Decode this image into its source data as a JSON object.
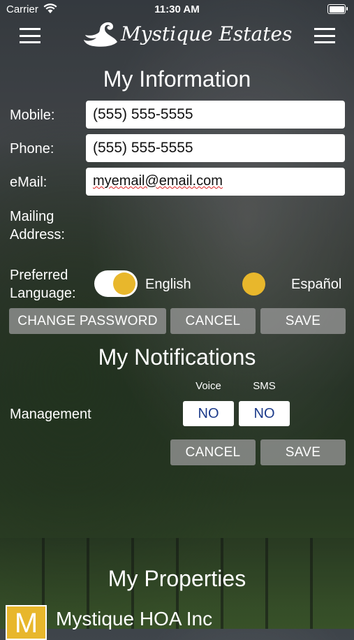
{
  "status_bar": {
    "carrier": "Carrier",
    "time": "11:30 AM"
  },
  "header": {
    "brand": "Mystique Estates"
  },
  "info": {
    "title": "My Information",
    "mobile_label": "Mobile:",
    "mobile_value": "(555) 555-5555",
    "phone_label": "Phone:",
    "phone_value": "(555) 555-5555",
    "email_label": "eMail:",
    "email_value": "myemail@email.com",
    "mailing_label_1": "Mailing",
    "mailing_label_2": "Address:",
    "language_label_1": "Preferred",
    "language_label_2": "Language:",
    "language_english": "English",
    "language_espanol": "Español",
    "english_selected": true,
    "buttons": {
      "change_password": "CHANGE PASSWORD",
      "cancel": "CANCEL",
      "save": "SAVE"
    }
  },
  "notifications": {
    "title": "My Notifications",
    "voice_label": "Voice",
    "sms_label": "SMS",
    "management_label": "Management",
    "voice_value": "NO",
    "sms_value": "NO",
    "buttons": {
      "cancel": "CANCEL",
      "save": "SAVE"
    }
  },
  "properties": {
    "title": "My Properties",
    "items": [
      {
        "icon_letter": "M",
        "name": "Mystique HOA Inc"
      }
    ]
  },
  "colors": {
    "accent": "#e8b72c",
    "button_gray": "#969696",
    "button_text_blue": "#1b3a8a"
  }
}
